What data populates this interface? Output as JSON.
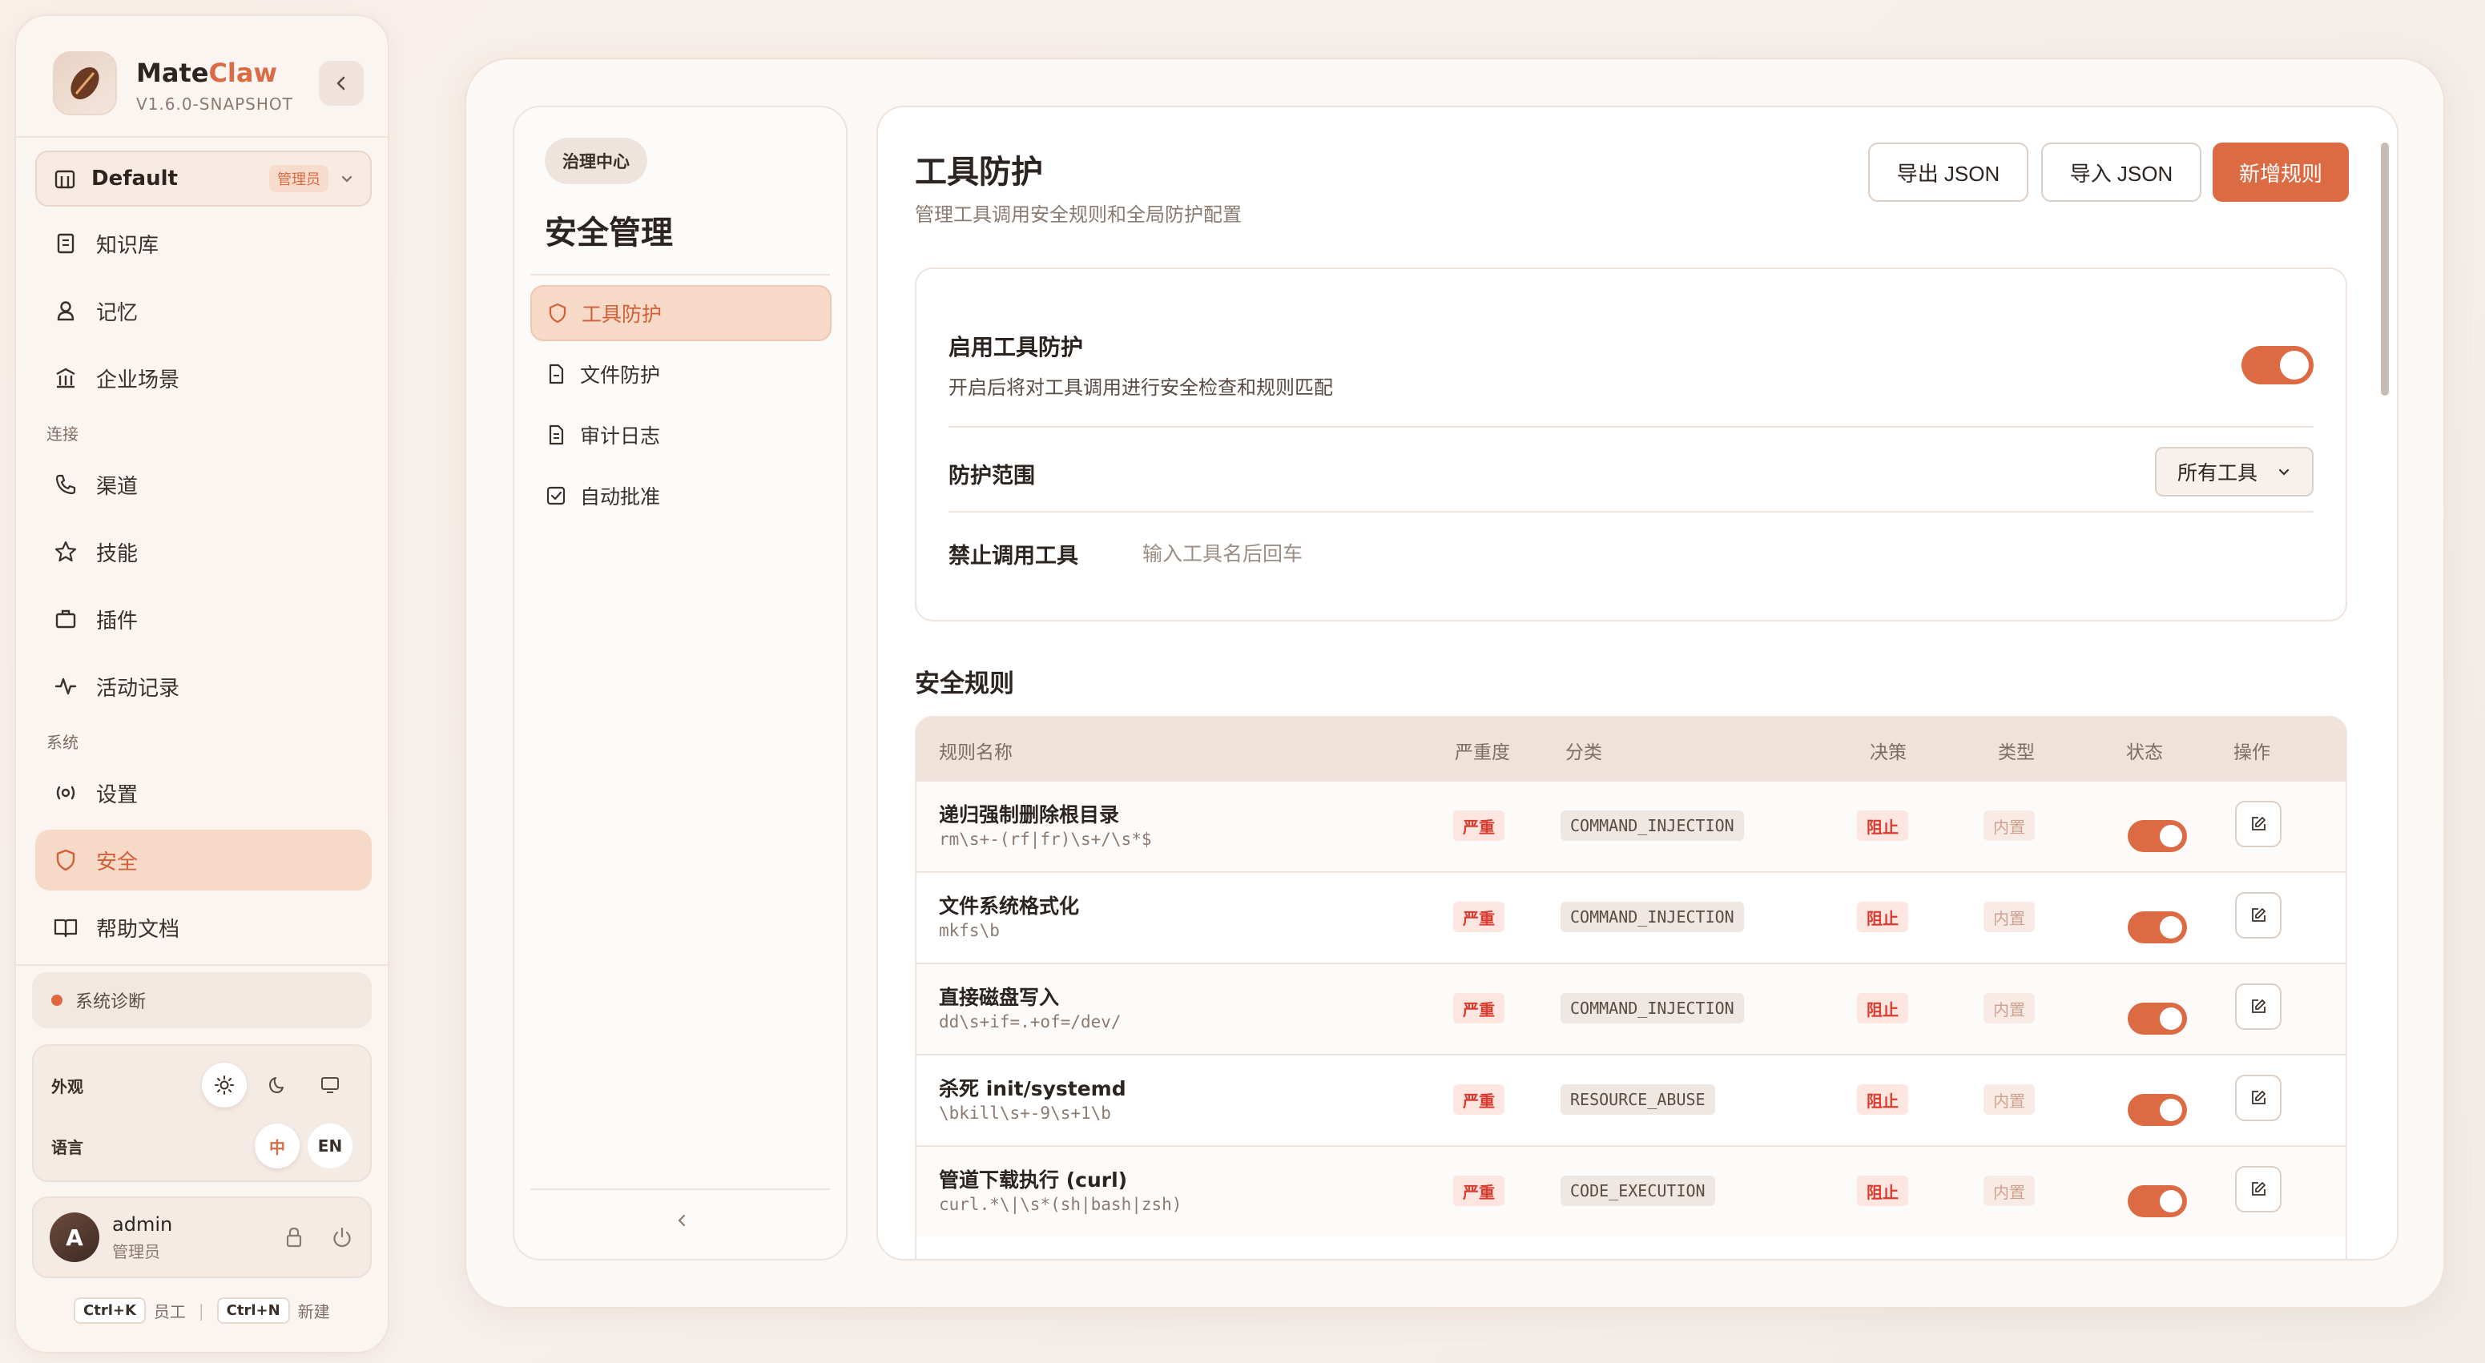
{
  "app": {
    "name_main": "Mate",
    "name_accent": "Claw",
    "version": "V1.6.0-SNAPSHOT",
    "colors": {
      "accent": "#dc6a43",
      "accent_text": "#d0603a",
      "danger": "#d93b2f",
      "active_bg": "#f7d9c8"
    }
  },
  "workspace": {
    "name": "Default",
    "badge": "管理员",
    "icon": "building-icon"
  },
  "sidebar": {
    "items_top": [
      {
        "label": "知识库",
        "icon": "book-icon"
      },
      {
        "label": "记忆",
        "icon": "user-icon"
      },
      {
        "label": "企业场景",
        "icon": "building-icon"
      }
    ],
    "section_connect": "连接",
    "items_connect": [
      {
        "label": "渠道",
        "icon": "phone-icon"
      },
      {
        "label": "技能",
        "icon": "star-icon"
      },
      {
        "label": "插件",
        "icon": "briefcase-icon"
      },
      {
        "label": "活动记录",
        "icon": "activity-icon"
      }
    ],
    "section_system": "系统",
    "items_system": [
      {
        "label": "设置",
        "icon": "settings-icon"
      },
      {
        "label": "安全",
        "icon": "shield-icon",
        "active": true
      },
      {
        "label": "帮助文档",
        "icon": "book-open-icon"
      }
    ],
    "diagnostics": "系统诊断",
    "appearance_label": "外观",
    "language_label": "语言",
    "lang_zh": "中",
    "lang_en": "EN",
    "user": {
      "initial": "A",
      "name": "admin",
      "role": "管理员"
    },
    "shortcuts": [
      {
        "key": "Ctrl+K",
        "label": "员工"
      },
      {
        "key": "Ctrl+N",
        "label": "新建"
      }
    ],
    "shortcut_sep": "|"
  },
  "governance": {
    "chip": "治理中心",
    "title": "安全管理",
    "items": [
      {
        "label": "工具防护",
        "icon": "shield-icon",
        "active": true
      },
      {
        "label": "文件防护",
        "icon": "file-icon"
      },
      {
        "label": "审计日志",
        "icon": "file-text-icon"
      },
      {
        "label": "自动批准",
        "icon": "check-square-icon"
      }
    ]
  },
  "main": {
    "title": "工具防护",
    "subtitle": "管理工具调用安全规则和全局防护配置",
    "btn_export": "导出 JSON",
    "btn_import": "导入 JSON",
    "btn_new": "新增规则",
    "enable_title": "启用工具防护",
    "enable_desc": "开启后将对工具调用进行安全检查和规则匹配",
    "enable_on": true,
    "scope_label": "防护范围",
    "scope_value": "所有工具",
    "blocked_label": "禁止调用工具",
    "blocked_placeholder": "输入工具名后回车",
    "rules_title": "安全规则",
    "columns": [
      "规则名称",
      "严重度",
      "分类",
      "决策",
      "类型",
      "状态",
      "操作"
    ],
    "rules": [
      {
        "name": "递归强制删除根目录",
        "pattern": "rm\\s+-(rf|fr)\\s+/\\s*$",
        "severity": "严重",
        "category": "COMMAND_INJECTION",
        "decision": "阻止",
        "type": "内置",
        "enabled": true
      },
      {
        "name": "文件系统格式化",
        "pattern": "mkfs\\b",
        "severity": "严重",
        "category": "COMMAND_INJECTION",
        "decision": "阻止",
        "type": "内置",
        "enabled": true
      },
      {
        "name": "直接磁盘写入",
        "pattern": "dd\\s+if=.+of=/dev/",
        "severity": "严重",
        "category": "COMMAND_INJECTION",
        "decision": "阻止",
        "type": "内置",
        "enabled": true
      },
      {
        "name": "杀死 init/systemd",
        "pattern": "\\bkill\\s+-9\\s+1\\b",
        "severity": "严重",
        "category": "RESOURCE_ABUSE",
        "decision": "阻止",
        "type": "内置",
        "enabled": true
      },
      {
        "name": "管道下载执行 (curl)",
        "pattern": "curl.*\\|\\s*(sh|bash|zsh)",
        "severity": "严重",
        "category": "CODE_EXECUTION",
        "decision": "阻止",
        "type": "内置",
        "enabled": true
      }
    ]
  }
}
